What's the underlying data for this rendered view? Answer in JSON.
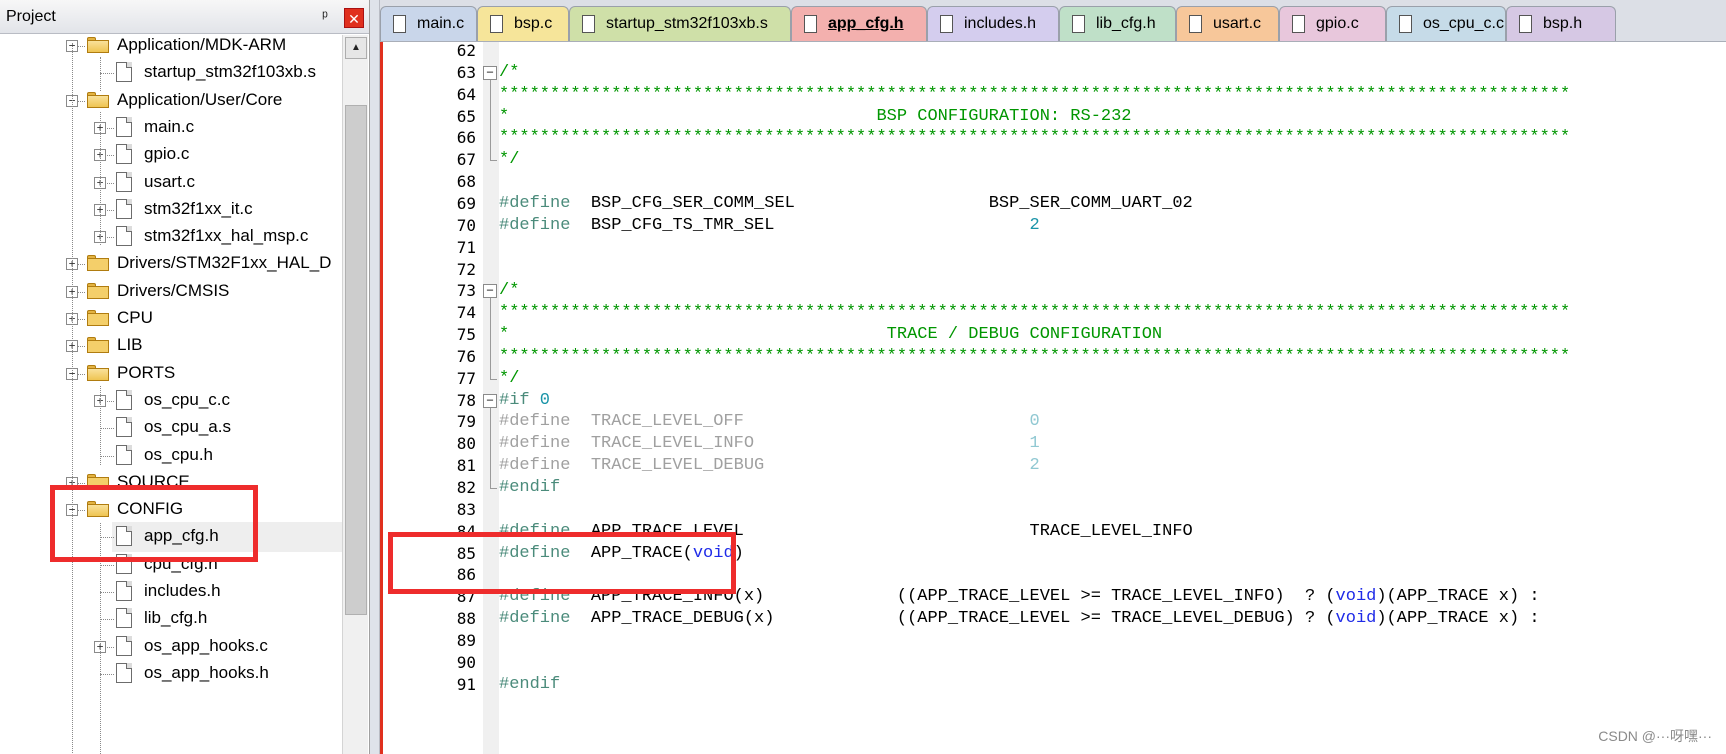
{
  "panel": {
    "title": "Project",
    "pin_glyph": "ᵖ",
    "close_glyph": "✕"
  },
  "tree": [
    {
      "label": "Application/MDK-ARM",
      "kind": "folder",
      "state": "open",
      "level": 0
    },
    {
      "label": "startup_stm32f103xb.s",
      "kind": "file",
      "level": 1
    },
    {
      "label": "Application/User/Core",
      "kind": "folder",
      "state": "open",
      "level": 0
    },
    {
      "label": "main.c",
      "kind": "file",
      "expand": "+",
      "level": 1
    },
    {
      "label": "gpio.c",
      "kind": "file",
      "expand": "+",
      "level": 1
    },
    {
      "label": "usart.c",
      "kind": "file",
      "expand": "+",
      "level": 1
    },
    {
      "label": "stm32f1xx_it.c",
      "kind": "file",
      "expand": "+",
      "level": 1
    },
    {
      "label": "stm32f1xx_hal_msp.c",
      "kind": "file",
      "expand": "+",
      "level": 1
    },
    {
      "label": "Drivers/STM32F1xx_HAL_D",
      "kind": "folder",
      "state": "closed",
      "level": 0
    },
    {
      "label": "Drivers/CMSIS",
      "kind": "folder",
      "state": "closed",
      "level": 0
    },
    {
      "label": "CPU",
      "kind": "folder",
      "state": "closed",
      "level": 0
    },
    {
      "label": "LIB",
      "kind": "folder",
      "state": "closed",
      "level": 0
    },
    {
      "label": "PORTS",
      "kind": "folder",
      "state": "open",
      "level": 0
    },
    {
      "label": "os_cpu_c.c",
      "kind": "file",
      "expand": "+",
      "level": 1
    },
    {
      "label": "os_cpu_a.s",
      "kind": "file",
      "level": 1
    },
    {
      "label": "os_cpu.h",
      "kind": "file",
      "level": 1
    },
    {
      "label": "SOURCE",
      "kind": "folder",
      "state": "closed",
      "level": 0
    },
    {
      "label": "CONFIG",
      "kind": "folder",
      "state": "open",
      "level": 0
    },
    {
      "label": "app_cfg.h",
      "kind": "file",
      "level": 1,
      "selected": true
    },
    {
      "label": "cpu_cfg.h",
      "kind": "file",
      "level": 1
    },
    {
      "label": "includes.h",
      "kind": "file",
      "level": 1
    },
    {
      "label": "lib_cfg.h",
      "kind": "file",
      "level": 1
    },
    {
      "label": "os_app_hooks.c",
      "kind": "file",
      "expand": "+",
      "level": 1
    },
    {
      "label": "os_app_hooks.h",
      "kind": "file",
      "level": 1
    }
  ],
  "tabs": [
    {
      "label": "main.c",
      "color": "#c9d6ea",
      "active": false
    },
    {
      "label": "bsp.c",
      "color": "#f6e59a",
      "active": false
    },
    {
      "label": "startup_stm32f103xb.s",
      "color": "#cfe0a8",
      "active": false
    },
    {
      "label": "app_cfg.h",
      "color": "#f3b0ae",
      "active": true
    },
    {
      "label": "includes.h",
      "color": "#d4cdee",
      "active": false
    },
    {
      "label": "lib_cfg.h",
      "color": "#bfe0c8",
      "active": false
    },
    {
      "label": "usart.c",
      "color": "#f7c79a",
      "active": false
    },
    {
      "label": "gpio.c",
      "color": "#e8c7dc",
      "active": false
    },
    {
      "label": "os_cpu_c.c",
      "color": "#c6dbe8",
      "active": false
    },
    {
      "label": "bsp.h",
      "color": "#d6c8e4",
      "active": false
    }
  ],
  "code_lines": [
    {
      "num": "62",
      "segments": []
    },
    {
      "num": "63",
      "fold": "minus",
      "segments": [
        [
          "cmt",
          "/*"
        ]
      ]
    },
    {
      "num": "64",
      "segments": [
        [
          "cmt",
          "*********************************************************************************************************"
        ]
      ]
    },
    {
      "num": "65",
      "segments": [
        [
          "cmt",
          "*                                    BSP CONFIGURATION: RS-232"
        ]
      ]
    },
    {
      "num": "66",
      "segments": [
        [
          "cmt",
          "*********************************************************************************************************"
        ]
      ]
    },
    {
      "num": "67",
      "fold": "end",
      "segments": [
        [
          "cmt",
          "*/"
        ]
      ]
    },
    {
      "num": "68",
      "segments": []
    },
    {
      "num": "69",
      "segments": [
        [
          "pp",
          "#define"
        ],
        [
          "",
          "  BSP_CFG_SER_COMM_SEL                   BSP_SER_COMM_UART_02"
        ]
      ]
    },
    {
      "num": "70",
      "segments": [
        [
          "pp",
          "#define"
        ],
        [
          "",
          "  BSP_CFG_TS_TMR_SEL                         "
        ],
        [
          "num",
          "2"
        ]
      ]
    },
    {
      "num": "71",
      "segments": []
    },
    {
      "num": "72",
      "segments": []
    },
    {
      "num": "73",
      "fold": "minus",
      "segments": [
        [
          "cmt",
          "/*"
        ]
      ]
    },
    {
      "num": "74",
      "segments": [
        [
          "cmt",
          "*********************************************************************************************************"
        ]
      ]
    },
    {
      "num": "75",
      "segments": [
        [
          "cmt",
          "*                                     TRACE / DEBUG CONFIGURATION"
        ]
      ]
    },
    {
      "num": "76",
      "segments": [
        [
          "cmt",
          "*********************************************************************************************************"
        ]
      ]
    },
    {
      "num": "77",
      "fold": "end",
      "segments": [
        [
          "cmt",
          "*/"
        ]
      ]
    },
    {
      "num": "78",
      "fold": "minus",
      "segments": [
        [
          "pp",
          "#if"
        ],
        [
          "num",
          " 0"
        ]
      ]
    },
    {
      "num": "79",
      "segments": [
        [
          "grey",
          "#define  TRACE_LEVEL_OFF                            "
        ],
        [
          "grey-num",
          "0"
        ]
      ]
    },
    {
      "num": "80",
      "segments": [
        [
          "grey",
          "#define  TRACE_LEVEL_INFO                           "
        ],
        [
          "grey-num",
          "1"
        ]
      ]
    },
    {
      "num": "81",
      "segments": [
        [
          "grey",
          "#define  TRACE_LEVEL_DEBUG                          "
        ],
        [
          "grey-num",
          "2"
        ]
      ]
    },
    {
      "num": "82",
      "fold": "end",
      "segments": [
        [
          "pp",
          "#endif"
        ]
      ]
    },
    {
      "num": "83",
      "segments": []
    },
    {
      "num": "84",
      "segments": [
        [
          "pp",
          "#define"
        ],
        [
          "",
          "  APP_TRACE_LEVEL                            TRACE_LEVEL_INFO"
        ]
      ]
    },
    {
      "num": "85",
      "segments": [
        [
          "pp",
          "#define"
        ],
        [
          "",
          "  APP_TRACE("
        ],
        [
          "kw",
          "void"
        ],
        [
          "",
          ")"
        ]
      ]
    },
    {
      "num": "86",
      "segments": []
    },
    {
      "num": "87",
      "segments": [
        [
          "pp",
          "#define"
        ],
        [
          "",
          "  APP_TRACE_INFO(x)             ((APP_TRACE_LEVEL >= TRACE_LEVEL_INFO)  ? ("
        ],
        [
          "kw",
          "void"
        ],
        [
          "",
          ")(APP_TRACE x) :"
        ]
      ]
    },
    {
      "num": "88",
      "segments": [
        [
          "pp",
          "#define"
        ],
        [
          "",
          "  APP_TRACE_DEBUG(x)            ((APP_TRACE_LEVEL >= TRACE_LEVEL_DEBUG) ? ("
        ],
        [
          "kw",
          "void"
        ],
        [
          "",
          ")(APP_TRACE x) :"
        ]
      ]
    },
    {
      "num": "89",
      "segments": []
    },
    {
      "num": "90",
      "segments": []
    },
    {
      "num": "91",
      "segments": [
        [
          "pp",
          "#endif"
        ]
      ]
    }
  ],
  "watermark": "CSDN @···呀嘿···",
  "colors": {
    "highlight": "#ee2c2c",
    "comment": "#009600",
    "keyword": "#1f2be8",
    "number": "#1a94a8"
  }
}
